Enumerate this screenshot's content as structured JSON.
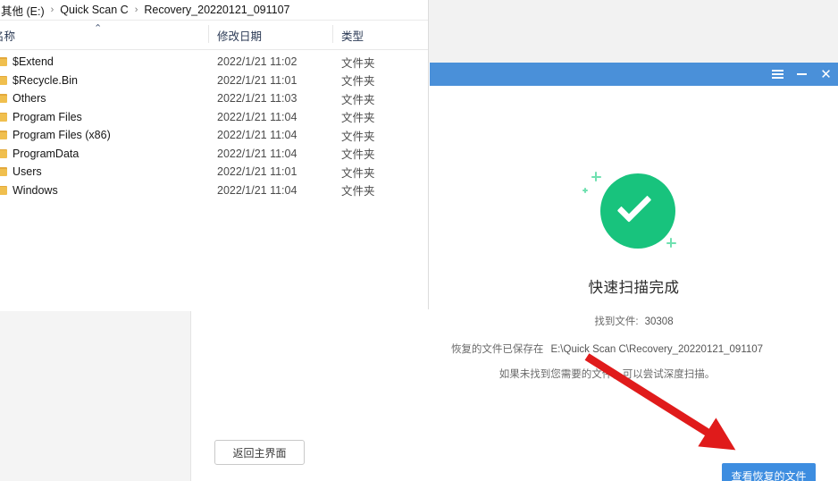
{
  "explorer": {
    "breadcrumb": {
      "items": [
        "其他 (E:)",
        "Quick Scan C",
        "Recovery_20220121_091107"
      ],
      "separator": "›"
    },
    "columns": {
      "name": "名称",
      "date_modified": "修改日期",
      "type": "类型",
      "sort_indicator": "⌃"
    },
    "rows": [
      {
        "name": "$Extend",
        "date": "2022/1/21 11:02",
        "type": "文件夹",
        "icon": "folder-icon"
      },
      {
        "name": "$Recycle.Bin",
        "date": "2022/1/21 11:01",
        "type": "文件夹",
        "icon": "folder-icon"
      },
      {
        "name": "Others",
        "date": "2022/1/21 11:03",
        "type": "文件夹",
        "icon": "folder-icon"
      },
      {
        "name": "Program Files",
        "date": "2022/1/21 11:04",
        "type": "文件夹",
        "icon": "folder-icon"
      },
      {
        "name": "Program Files (x86)",
        "date": "2022/1/21 11:04",
        "type": "文件夹",
        "icon": "folder-icon"
      },
      {
        "name": "ProgramData",
        "date": "2022/1/21 11:04",
        "type": "文件夹",
        "icon": "folder-icon"
      },
      {
        "name": "Users",
        "date": "2022/1/21 11:01",
        "type": "文件夹",
        "icon": "folder-icon"
      },
      {
        "name": "Windows",
        "date": "2022/1/21 11:04",
        "type": "文件夹",
        "icon": "文件夹"
      }
    ]
  },
  "app": {
    "titlebar": {
      "menu_icon": "hamburger-icon",
      "minimize_icon": "minimize-icon",
      "close_icon": "close-icon",
      "background": "#4a90d9"
    },
    "status": {
      "icon": "success-check-icon",
      "icon_color": "#18c37d",
      "title": "快速扫描完成",
      "found_label": "找到文件:",
      "found_count": "30308",
      "saved_label": "恢复的文件已保存在",
      "saved_path": "E:\\Quick Scan C\\Recovery_20220121_091107",
      "hint": "如果未找到您需要的文件，可以尝试深度扫描。"
    },
    "buttons": {
      "back": "返回主界面",
      "view_recovered": "查看恢复的文件",
      "primary_color": "#3d8de0"
    }
  },
  "annotation": {
    "arrow_color": "#e01b1b"
  }
}
